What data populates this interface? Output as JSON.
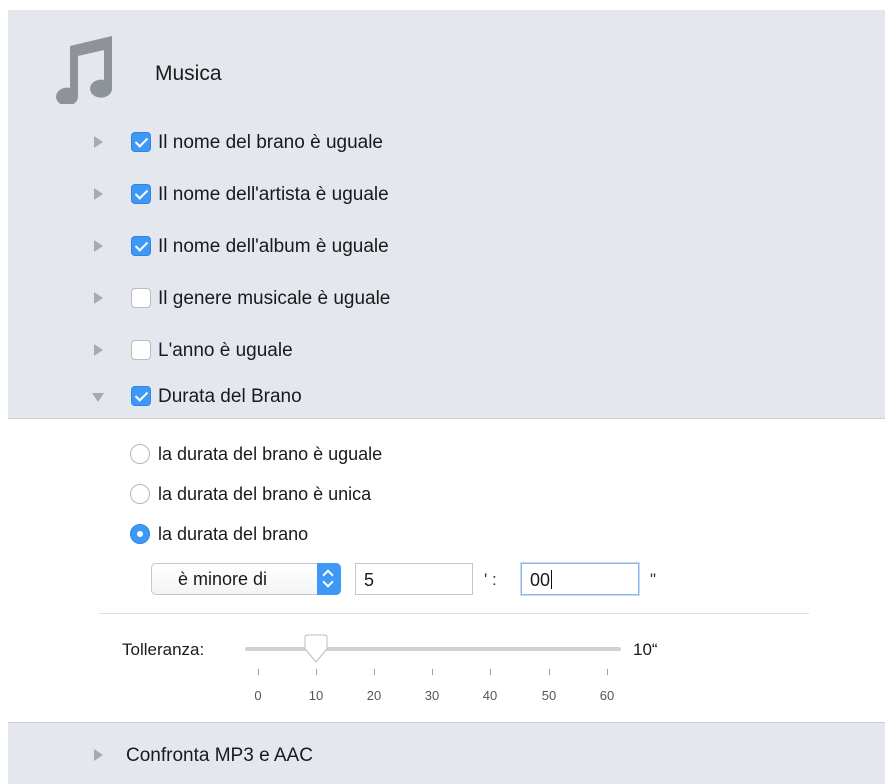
{
  "section": {
    "title": "Musica",
    "icon": "music-note-icon"
  },
  "criteria": [
    {
      "label": "Il nome del brano è uguale",
      "checked": true,
      "expanded": false
    },
    {
      "label": "Il nome dell'artista è uguale",
      "checked": true,
      "expanded": false
    },
    {
      "label": "Il nome dell'album è uguale",
      "checked": true,
      "expanded": false
    },
    {
      "label": "Il genere musicale è uguale",
      "checked": false,
      "expanded": false
    },
    {
      "label": "L'anno è uguale",
      "checked": false,
      "expanded": false
    },
    {
      "label": "Durata del Brano",
      "checked": true,
      "expanded": true
    }
  ],
  "duration": {
    "options": [
      {
        "label": "la durata del brano è uguale",
        "selected": false
      },
      {
        "label": "la durata del brano è unica",
        "selected": false
      },
      {
        "label": "la durata del brano",
        "selected": true
      }
    ],
    "comparison": {
      "value": "è minore di"
    },
    "minutes": "5",
    "minutes_sep": "' :",
    "seconds": "00",
    "seconds_sep": "\""
  },
  "tolerance": {
    "label": "Tolleranza:",
    "value": 10,
    "value_text": "10“",
    "min": 0,
    "max": 60,
    "ticks": [
      "0",
      "10",
      "20",
      "30",
      "40",
      "50",
      "60"
    ]
  },
  "bottom": {
    "label": "Confronta MP3 e AAC"
  },
  "colors": {
    "accent": "#3d99f5",
    "section_bg": "#e4e7ed",
    "icon_gray": "#8e9299"
  }
}
